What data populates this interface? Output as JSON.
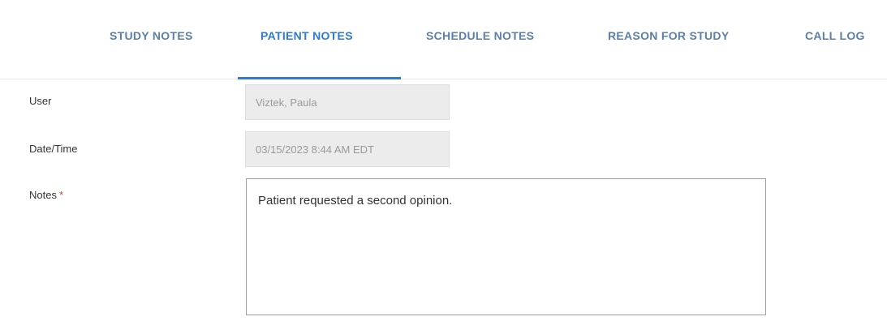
{
  "tabs": [
    {
      "label": "STUDY NOTES",
      "active": false
    },
    {
      "label": "PATIENT NOTES",
      "active": true
    },
    {
      "label": "SCHEDULE NOTES",
      "active": false
    },
    {
      "label": "REASON FOR STUDY",
      "active": false
    },
    {
      "label": "CALL LOG",
      "active": false
    }
  ],
  "form": {
    "user_label": "User",
    "user_value": "Viztek, Paula",
    "datetime_label": "Date/Time",
    "datetime_value": "03/15/2023 8:44 AM EDT",
    "notes_label": "Notes",
    "required_marker": "*",
    "notes_value": "Patient requested a second opinion."
  },
  "colors": {
    "tab_text": "#5b7fa8",
    "tab_active": "#2e7bd6",
    "required": "#d0453c",
    "readonly_bg": "#ececec"
  }
}
